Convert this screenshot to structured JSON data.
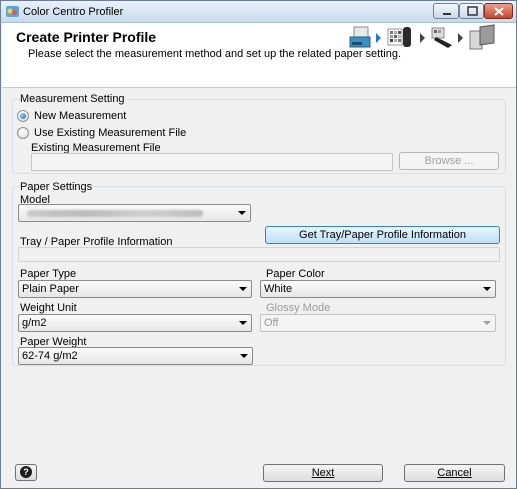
{
  "window": {
    "title": "Color Centro Profiler"
  },
  "header": {
    "title": "Create Printer Profile",
    "subtitle": "Please select the measurement method and set up the related paper setting."
  },
  "measurement": {
    "group_label": "Measurement Setting",
    "new_label": "New Measurement",
    "existing_label": "Use Existing Measurement File",
    "existing_file_label": "Existing Measurement File",
    "existing_file_value": "",
    "browse_label": "Browse ...",
    "selected": "new"
  },
  "paper": {
    "group_label": "Paper Settings",
    "model_label": "Model",
    "tray_info_label": "Tray / Paper Profile Information",
    "tray_info_value": "",
    "get_info_button": "Get Tray/Paper Profile Information",
    "paper_type_label": "Paper Type",
    "paper_type_value": "Plain Paper",
    "paper_color_label": "Paper Color",
    "paper_color_value": "White",
    "weight_unit_label": "Weight Unit",
    "weight_unit_value": "g/m2",
    "glossy_mode_label": "Glossy Mode",
    "glossy_mode_value": "Off",
    "paper_weight_label": "Paper Weight",
    "paper_weight_value": "62-74 g/m2"
  },
  "footer": {
    "help_glyph": "?",
    "next_label": "Next",
    "cancel_label": "Cancel"
  },
  "icons": [
    "app-icon",
    "minimize-icon",
    "maximize-icon",
    "close-icon",
    "printer-step-icon",
    "chart-step-icon",
    "measure-step-icon",
    "profile-step-icon",
    "help-icon",
    "dropdown-arrow-icon"
  ]
}
